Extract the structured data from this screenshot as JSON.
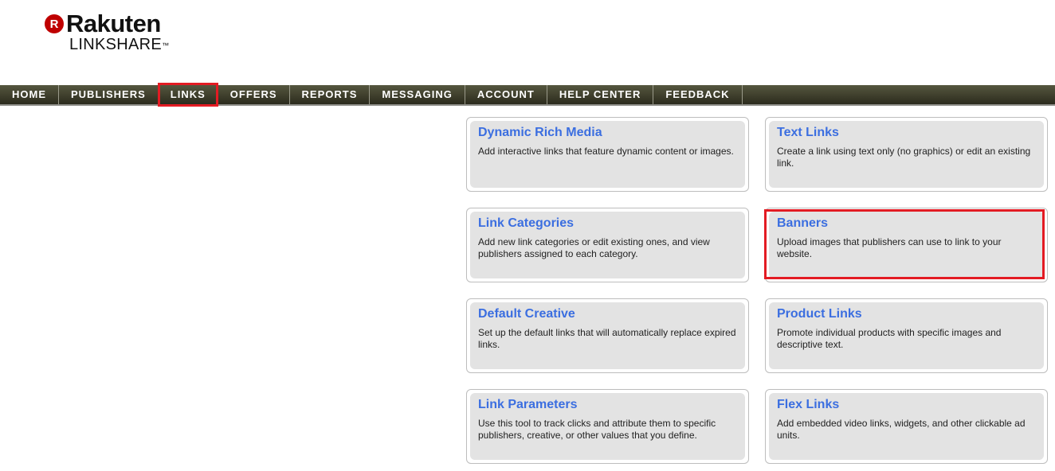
{
  "logo": {
    "brand": "Rakuten",
    "badge": "R",
    "product": "LINKSHARE",
    "tm": "™"
  },
  "nav": {
    "items": [
      {
        "label": "HOME"
      },
      {
        "label": "PUBLISHERS"
      },
      {
        "label": "LINKS",
        "active": true
      },
      {
        "label": "OFFERS"
      },
      {
        "label": "REPORTS"
      },
      {
        "label": "MESSAGING"
      },
      {
        "label": "ACCOUNT"
      },
      {
        "label": "HELP CENTER"
      },
      {
        "label": "FEEDBACK"
      }
    ]
  },
  "cards": [
    {
      "title": "Dynamic Rich Media",
      "description": "Add interactive links that feature dynamic content or images."
    },
    {
      "title": "Text Links",
      "description": "Create a link using text only (no graphics) or edit an existing link."
    },
    {
      "title": "Link Categories",
      "description": "Add new link categories or edit existing ones, and view publishers assigned to each category."
    },
    {
      "title": "Banners",
      "description": "Upload images that publishers can use to link to your website.",
      "highlighted": true
    },
    {
      "title": "Default Creative",
      "description": "Set up the default links that will automatically replace expired links."
    },
    {
      "title": "Product Links",
      "description": "Promote individual products with specific images and descriptive text."
    },
    {
      "title": "Link Parameters",
      "description": "Use this tool to track clicks and attribute them to specific publishers, creative, or other values that you define."
    },
    {
      "title": "Flex Links",
      "description": "Add embedded video links, widgets, and other clickable ad units."
    }
  ],
  "colors": {
    "accent_link": "#3b6ee0",
    "highlight": "#e31b23",
    "nav_bg": "#3f3f2c",
    "brand_red": "#bf0000"
  }
}
